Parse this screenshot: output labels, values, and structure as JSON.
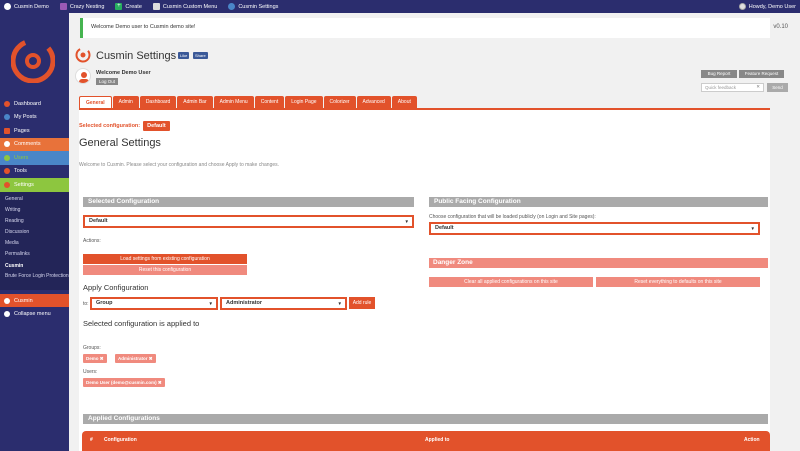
{
  "adminbar": {
    "items": [
      {
        "label": "Cusmin Demo",
        "icon": "wordpress-icon"
      },
      {
        "label": "Crazy Nesting",
        "icon": "nesting-icon"
      },
      {
        "label": "Create",
        "icon": "plus-icon"
      },
      {
        "label": "Cusmin Custom Menu",
        "icon": "bank-icon"
      },
      {
        "label": "Cusmin Settings",
        "icon": "gears-icon"
      }
    ],
    "howdy": "Howdy, Demo User"
  },
  "sidebar": {
    "items": [
      {
        "label": "Dashboard",
        "icon": "dashboard-icon"
      },
      {
        "label": "My Posts",
        "icon": "pin-icon"
      },
      {
        "label": "Pages",
        "icon": "pages-icon"
      },
      {
        "label": "Comments",
        "icon": "comment-icon"
      },
      {
        "label": "Users",
        "icon": "users-icon"
      },
      {
        "label": "Tools",
        "icon": "wrench-icon"
      },
      {
        "label": "Settings",
        "icon": "settings-icon"
      }
    ],
    "submenu": [
      "General",
      "Writing",
      "Reading",
      "Discussion",
      "Media",
      "Permalinks",
      "Cusmin",
      "Brute Force Login Protection"
    ],
    "cusmin": "Cusmin",
    "collapse": "Collapse menu"
  },
  "notice": "Welcome Demo user to Cusmin demo site!",
  "version": "v0.10",
  "page": {
    "title": "Cusmin Settings",
    "like": "Like",
    "share": "Share",
    "user_name": "Welcome Demo User",
    "logout": "Log Out",
    "bug_report": "Bug Report",
    "feature_request": "Feature Request",
    "quick_placeholder": "Quick feedback",
    "send": "Send"
  },
  "tabs": [
    "General",
    "Admin",
    "Dashboard",
    "Admin Bar",
    "Admin Menu",
    "Content",
    "Login Page",
    "Colorizer",
    "Advanced",
    "About"
  ],
  "selected_config_label": "Selected configuration:",
  "selected_config_value": "Default",
  "general_title": "General Settings",
  "welcome_text": "Welcome to Cusmin. Please select your configuration and choose Apply to make changes.",
  "left": {
    "section": "Selected Configuration",
    "select_value": "Default",
    "actions": "Actions:",
    "load_btn": "Load settings from existing configuration",
    "reset_btn": "Reset this configuration",
    "apply_title": "Apply Configuration",
    "to": "to:",
    "group_select": "Group",
    "role_select": "Administrator",
    "add_rule": "Add rule",
    "applied_to_title": "Selected configuration is applied to",
    "groups_label": "Groups:",
    "groups": [
      "Demo",
      "Administrator"
    ],
    "users_label": "Users:",
    "users": [
      "Demo User (demo@cusmin.com)"
    ]
  },
  "right": {
    "section": "Public Facing Configuration",
    "desc": "Choose configuration that will be loaded publicly (on Login and Site pages):",
    "select_value": "Default",
    "danger_zone": "Danger Zone",
    "clear_btn": "Clear all applied configurations on this site",
    "reset_btn": "Reset everything to defaults on this site"
  },
  "applied": {
    "section": "Applied Configurations",
    "col_hash": "#",
    "col_config": "Configuration",
    "col_applied": "Applied to",
    "col_action": "Action"
  }
}
